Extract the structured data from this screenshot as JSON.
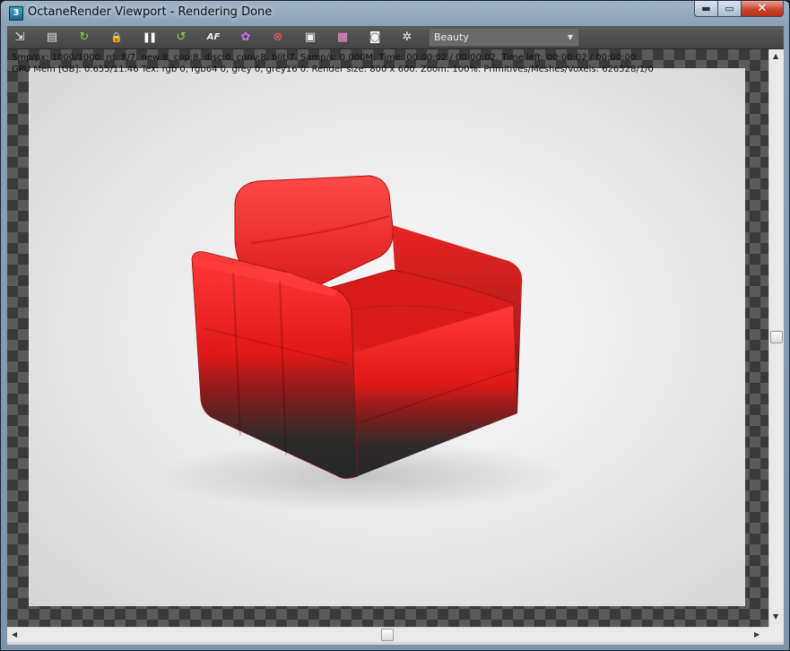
{
  "window": {
    "app_icon_text": "3",
    "title": "OctaneRender Viewport - Rendering Done",
    "minimize_glyph": "▬",
    "maximize_glyph": "▭",
    "close_glyph": "✕"
  },
  "toolbar": {
    "icons": [
      {
        "name": "send-scene-icon",
        "glyph": "⇲",
        "color": "#f0f0f0"
      },
      {
        "name": "save-image-icon",
        "glyph": "▤",
        "color": "#e0e0e0"
      },
      {
        "name": "restart-render-icon",
        "glyph": "↻",
        "color": "#7ddc4a"
      },
      {
        "name": "lock-icon",
        "glyph": "🔒",
        "color": "#f0f0f0"
      },
      {
        "name": "pause-icon",
        "glyph": "❚❚",
        "color": "#ffffff"
      },
      {
        "name": "refresh-icon",
        "glyph": "↺",
        "color": "#7ddc4a"
      },
      {
        "name": "autofocus-icon",
        "glyph": "AF",
        "color": "#f0f0f0"
      },
      {
        "name": "color-picker-icon",
        "glyph": "✿",
        "color": "#d06cff"
      },
      {
        "name": "material-picker-icon",
        "glyph": "⊗",
        "color": "#ff5a5a"
      },
      {
        "name": "region-render-icon",
        "glyph": "▣",
        "color": "#f0f0f0"
      },
      {
        "name": "film-settings-icon",
        "glyph": "▦",
        "color": "#ff8fd6"
      },
      {
        "name": "camera-icon",
        "glyph": "◙",
        "color": "#f0f0f0"
      },
      {
        "name": "settings-icon",
        "glyph": "✲",
        "color": "#f0f0f0"
      }
    ],
    "pass_select": {
      "value": "Beauty",
      "arrow": "▼"
    }
  },
  "stats": {
    "line1": "Smp/px: 1000/1000.   rd: 8/7.   new:8, cop:8, disc:0, conv:8, blit:7.   Samp/s: 0.000M.   Time: 00:00:02 / 00:00:02.   Time left: 00:00:02 / 00:00:00.",
    "line2": "GPU Mem [GB]: 0.655/11.46   Tex: rgb 0, rgb64 0, grey 0, grey16 0.   Render size: 800 x 600.   Zoom: 100%.   Primitives/Meshes/Voxels: 626528/1/0"
  },
  "render": {
    "subject": "red leather armchair",
    "chair_red": "#e02020",
    "fade_color": "#262626"
  },
  "scrollbars": {
    "up": "▲",
    "down": "▼",
    "left": "◀",
    "right": "▶",
    "vertical_position": 0.52,
    "horizontal_position": 0.5
  }
}
